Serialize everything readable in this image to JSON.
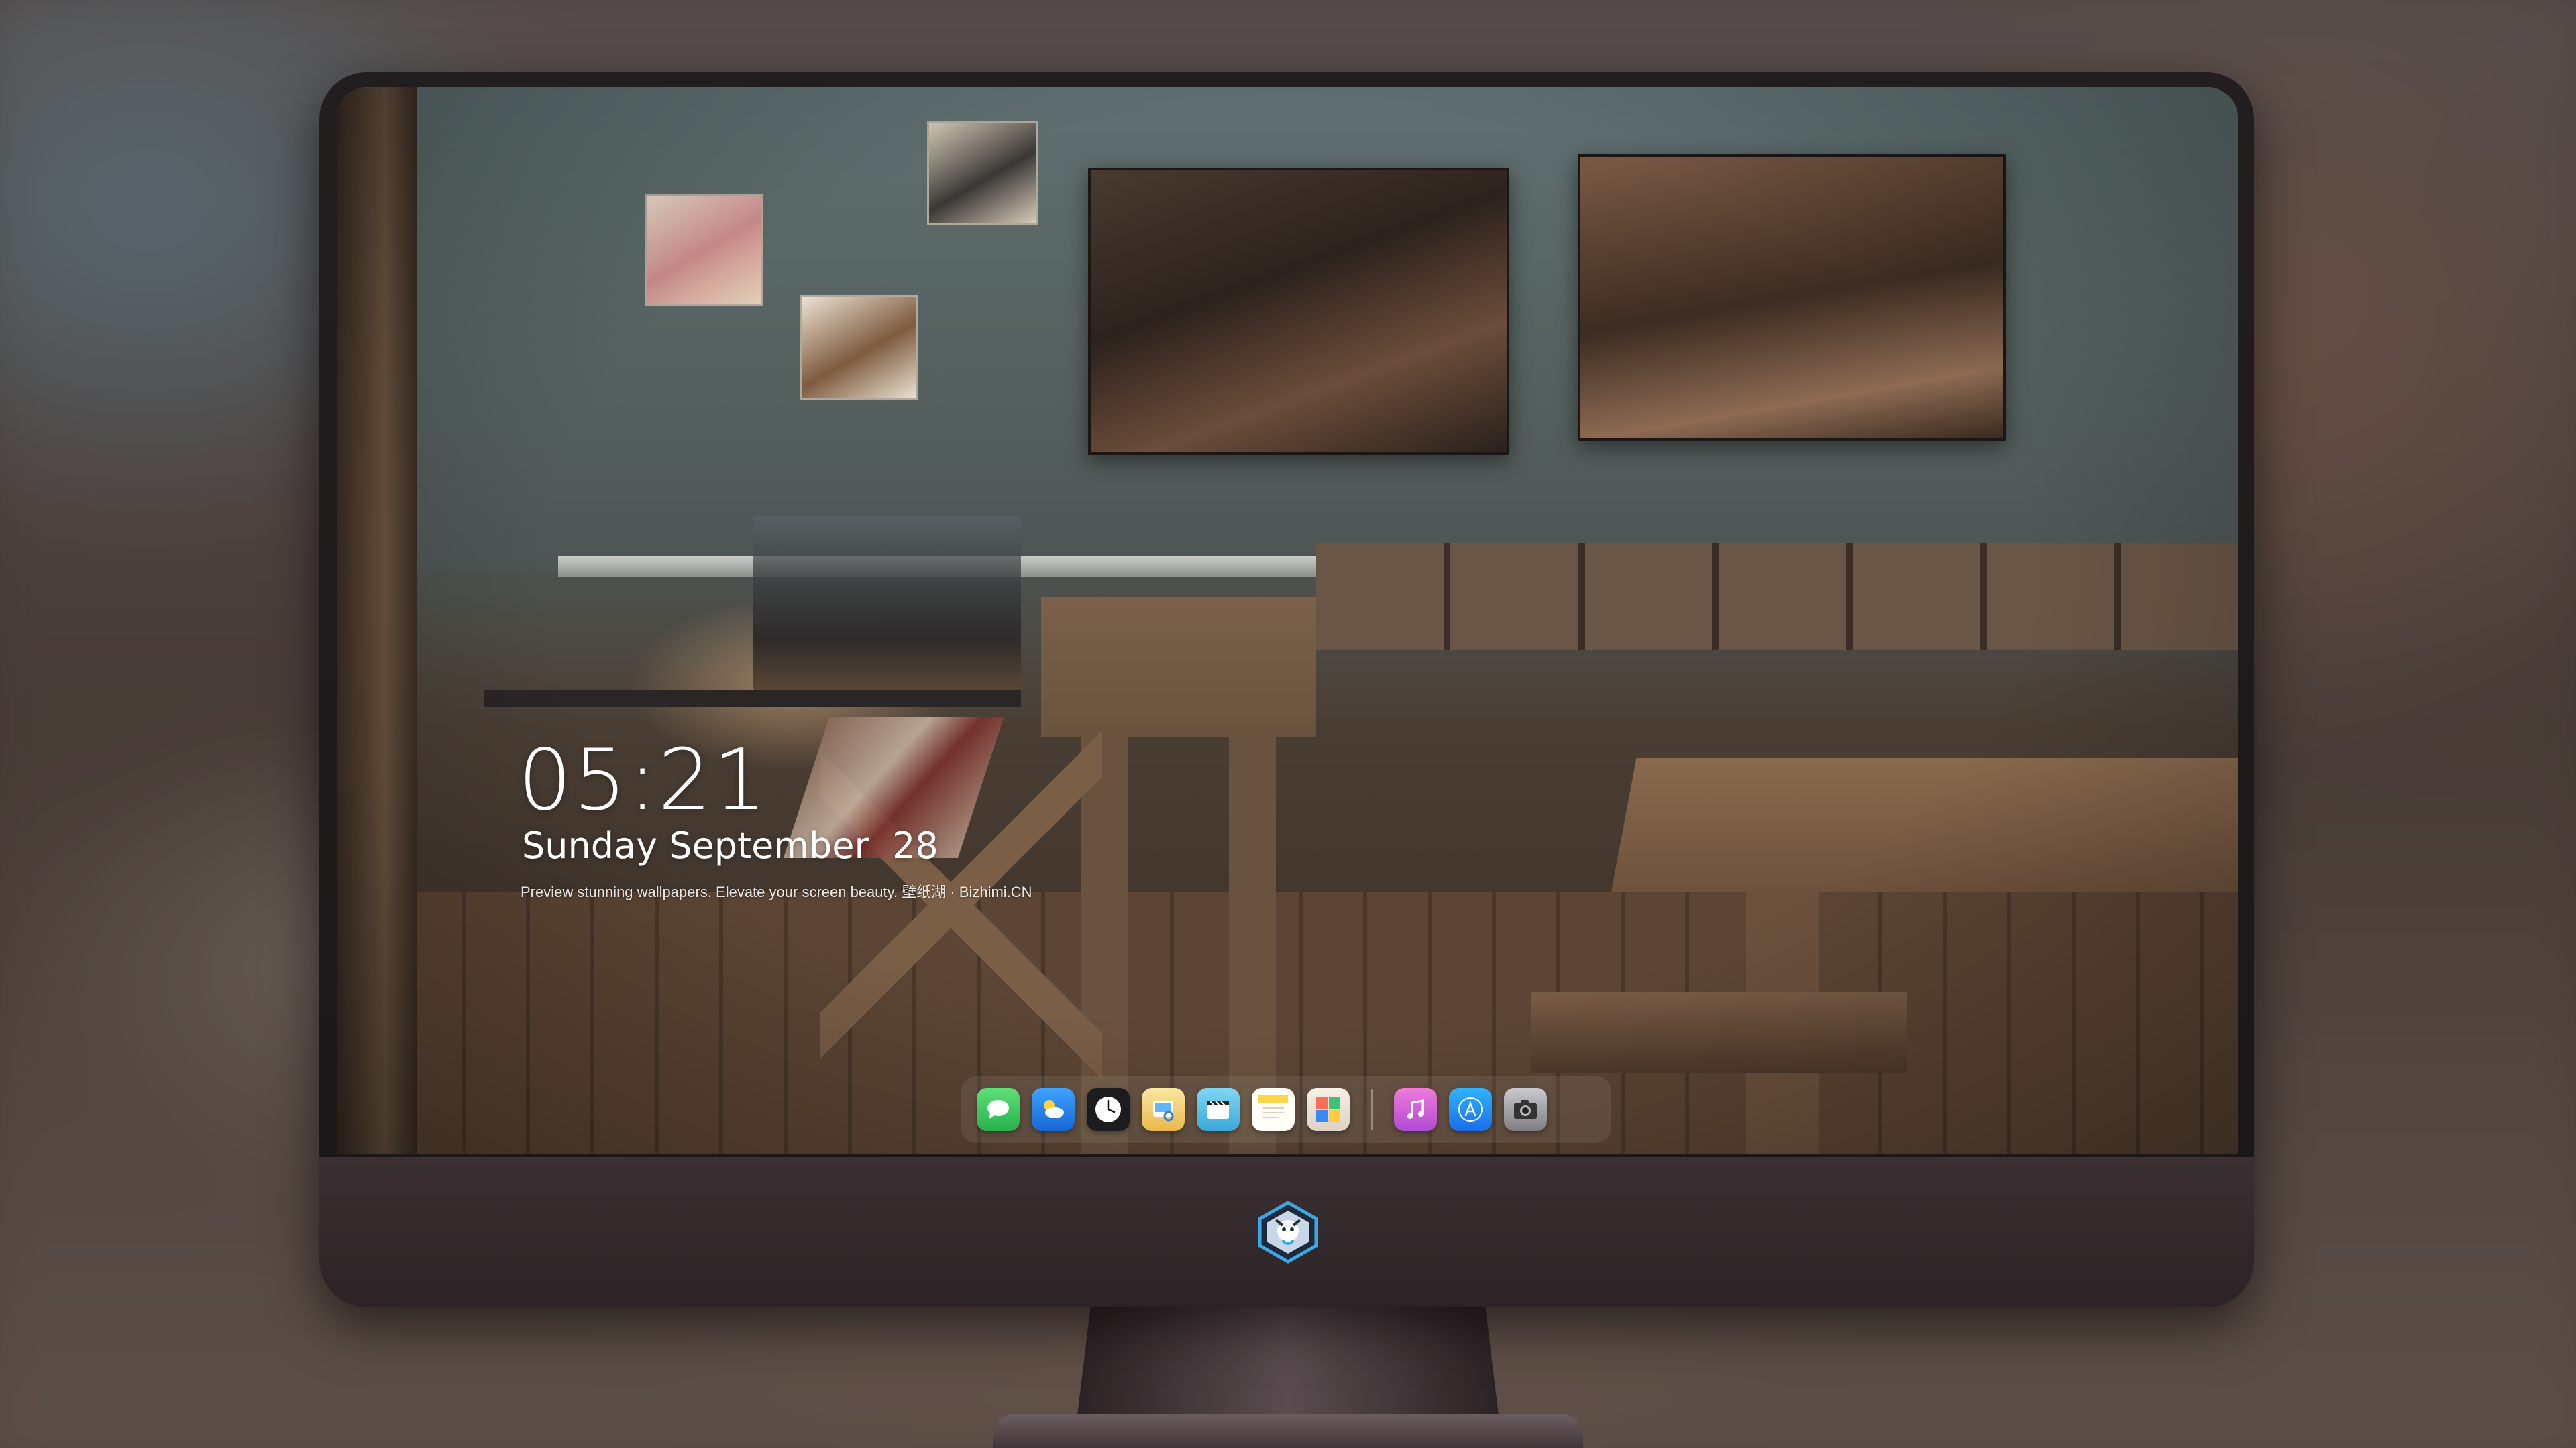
{
  "lockscreen": {
    "time": "05:21",
    "date": "Sunday September  28",
    "tagline": "Preview stunning wallpapers. Elevate your screen beauty. 壁纸湖 · Bizhimi.CN"
  },
  "dock": {
    "apps": [
      {
        "name": "Messages",
        "icon": "messages-icon",
        "color": "#35c659"
      },
      {
        "name": "Weather",
        "icon": "weather-icon",
        "color": "#1f7ee8"
      },
      {
        "name": "Clock",
        "icon": "clock-icon",
        "color": "#ffffff"
      },
      {
        "name": "Preview",
        "icon": "preview-icon",
        "color": "#f2c94c"
      },
      {
        "name": "Clips",
        "icon": "clips-icon",
        "color": "#5ac8e8"
      },
      {
        "name": "Notes",
        "icon": "notes-icon",
        "color": "#fbd44b"
      },
      {
        "name": "Photo Booth",
        "icon": "photo-booth-icon",
        "color": "#e85a4f"
      },
      {
        "name": "iTunes",
        "icon": "itunes-icon",
        "color": "#d86bd8"
      },
      {
        "name": "App Store",
        "icon": "app-store-icon",
        "color": "#1b8cf2"
      },
      {
        "name": "Camera",
        "icon": "camera-icon",
        "color": "#8e8e93"
      }
    ]
  },
  "colors": {
    "bezel": "#1d191a",
    "chin": "#332a2c",
    "text": "#ffffff"
  }
}
